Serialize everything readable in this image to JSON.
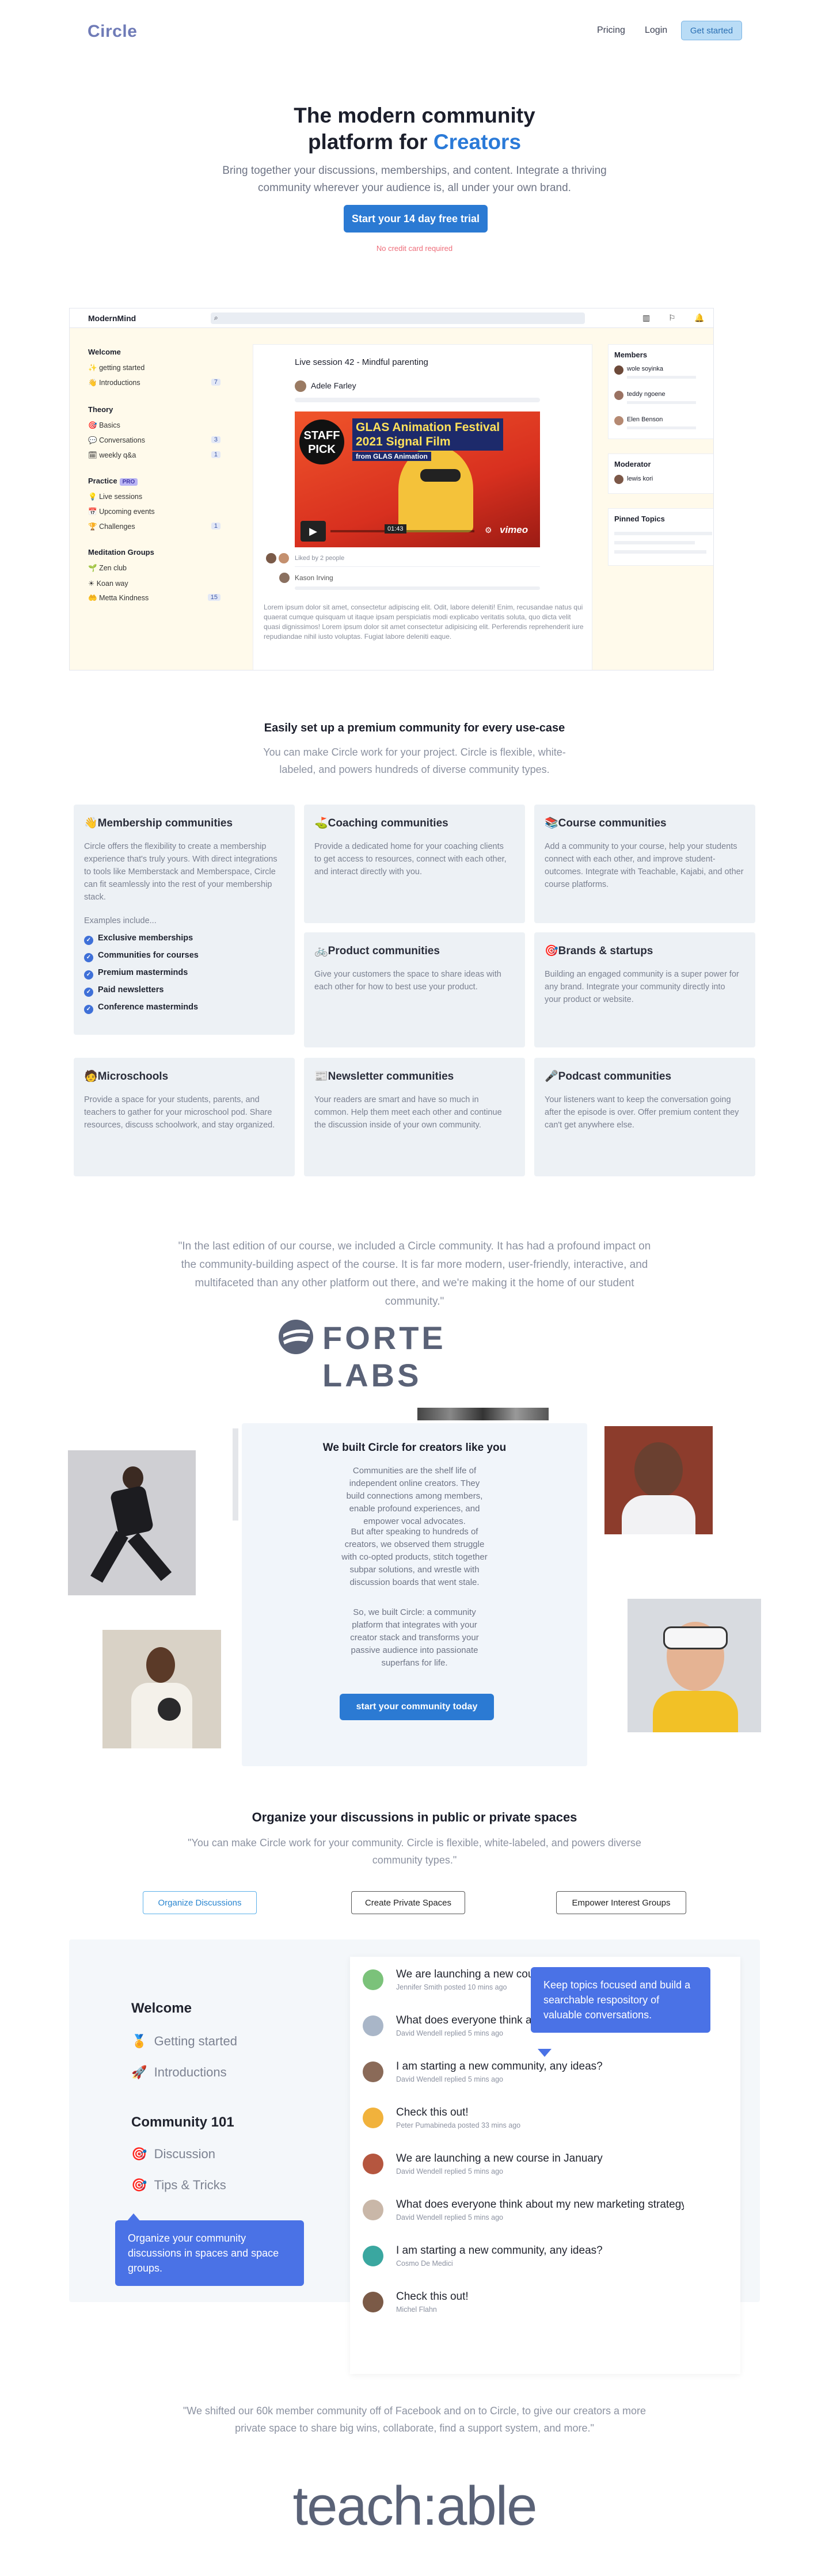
{
  "nav": {
    "logo": "Circle",
    "links": [
      "Pricing",
      "Login"
    ],
    "cta": "Get started"
  },
  "hero": {
    "title_line1": "The modern community",
    "title_line2_prefix": "platform for ",
    "title_line2_accent": "Creators",
    "subtitle": "Bring together your discussions, memberships, and content. Integrate a thriving community wherever your audience is, all under your own brand.",
    "cta": "Start your 14 day free trial",
    "note": "No credit card required"
  },
  "app": {
    "brand": "ModernMind",
    "sections": [
      {
        "title": "Welcome",
        "items": [
          {
            "label": "getting started",
            "icon": "✨",
            "count": ""
          },
          {
            "label": "Introductions",
            "icon": "👋",
            "count": "7"
          }
        ]
      },
      {
        "title": "Theory",
        "items": [
          {
            "label": "Basics",
            "icon": "🎯",
            "count": ""
          },
          {
            "label": "Conversations",
            "icon": "💬",
            "count": "3"
          },
          {
            "label": "weekly q&a",
            "icon": "🗓",
            "count": "1"
          }
        ]
      },
      {
        "title": "Practice",
        "pro": "PRO",
        "items": [
          {
            "label": "Live sessions",
            "icon": "💡",
            "count": ""
          },
          {
            "label": "Upcoming events",
            "icon": "📅",
            "count": ""
          },
          {
            "label": "Challenges",
            "icon": "🏆",
            "count": "1"
          }
        ]
      },
      {
        "title": "Meditation Groups",
        "items": [
          {
            "label": "Zen club",
            "icon": "🌱",
            "count": ""
          },
          {
            "label": "Koan way",
            "icon": "☀",
            "count": ""
          },
          {
            "label": "Metta Kindness",
            "icon": "🤲",
            "count": "15"
          }
        ]
      }
    ],
    "post_title": "Live session 42 - Mindful parenting",
    "author": "Adele Farley",
    "video": {
      "badge_line1": "STAFF",
      "badge_line2": "PICK",
      "title_line1": "GLAS Animation Festival",
      "title_line2": "2021 Signal Film",
      "from": "from GLAS Animation",
      "time": "01:43",
      "brand": "vimeo"
    },
    "liked": "Liked by 2 people",
    "commenter": "Kason Irving",
    "lorem": "Lorem ipsum dolor sit amet, consectetur adipiscing elit. Odit, labore deleniti! Enim, recusandae natus qui quaerat cumque quisquam ut itaque ipsam perspiciatis modi explicabo veritatis soluta, quo dicta velit quasi dignissimos! Lorem ipsum dolor sit amet consectetur adipisicing elit. Perferendis reprehenderit iure repudiandae nihil iusto voluptas. Fugiat labore deleniti eaque.",
    "members_title": "Members",
    "members": [
      "wole soyinka",
      "teddy ngoene",
      "Elen Benson"
    ],
    "moderator_title": "Moderator",
    "moderator": "lewis kori",
    "pinned_title": "Pinned Topics"
  },
  "usecases": {
    "title": "Easily set up a premium community for every use-case",
    "subtitle": "You can make Circle work for your project. Circle is flexible, white-labeled, and powers hundreds of diverse community types.",
    "cards": [
      {
        "title": "Membership communities",
        "icon": "👋",
        "text": "Circle offers the flexibility to create a membership experience that's truly yours. With direct integrations to tools like Memberstack and Memberspace, Circle can fit seamlessly into the rest of your membership stack.",
        "examples_label": "Examples include...",
        "examples": [
          "Exclusive memberships",
          "Communities for courses",
          "Premium masterminds",
          "Paid newsletters",
          "Conference masterminds"
        ]
      },
      {
        "title": "Coaching communities",
        "icon": "⛳",
        "text": "Provide a dedicated home for your coaching clients to get access to resources, connect with each other, and interact directly with you."
      },
      {
        "title": "Course communities",
        "icon": "📚",
        "text": "Add a community to your course, help your students connect with each other, and improve student-outcomes. Integrate with Teachable, Kajabi, and other course platforms."
      },
      {
        "title": "Product communities",
        "icon": "🚲",
        "text": "Give your customers the space to share ideas with each other for how to best use your product."
      },
      {
        "title": "Brands & startups",
        "icon": "🎯",
        "text": "Building an engaged community is a super power for any brand. Integrate your community directly into your product or website."
      },
      {
        "title": "Microschools",
        "icon": "🧑",
        "text": "Provide a space for your students, parents, and teachers to gather for your microschool pod. Share resources, discuss schoolwork, and stay organized."
      },
      {
        "title": "Newsletter communities",
        "icon": "📰",
        "text": "Your readers are smart and have so much in common. Help them meet each other and continue the discussion inside of your own community."
      },
      {
        "title": "Podcast communities",
        "icon": "🎤",
        "text": "Your listeners want to keep the conversation going after the episode is over. Offer premium content they can't get anywhere else."
      }
    ]
  },
  "quote1": {
    "text": "\"In the last edition of our course, we included a Circle community. It has had a profound impact on the community-building aspect of the course. It is far more modern, user-friendly, interactive, and multifaceted than any other platform out there, and we're making it the home of our student community.\"",
    "logo": "FORTE LABS"
  },
  "creators": {
    "title": "We built Circle for creators like you",
    "p1": "Communities are the shelf life of independent online creators. They build connections among members, enable profound experiences, and empower vocal advocates.",
    "p2": "But after speaking to hundreds of creators, we observed them struggle with co-opted products, stitch together subpar solutions, and wrestle with discussion boards that went stale.",
    "p3": "So, we built Circle: a community platform that integrates with your creator stack and transforms your passive audience into passionate superfans for life.",
    "cta": "start your community today"
  },
  "organize": {
    "title": "Organize your discussions in public or private spaces",
    "subtitle": "\"You can make Circle work for your community. Circle is flexible, white-labeled, and powers diverse community types.\"",
    "tabs": [
      "Organize Discussions",
      "Create Private Spaces",
      "Empower Interest Groups"
    ],
    "welcome": "Welcome",
    "welcome_items": [
      {
        "icon": "🏅",
        "label": "Getting started"
      },
      {
        "icon": "🚀",
        "label": "Introductions"
      }
    ],
    "community": "Community 101",
    "community_items": [
      {
        "icon": "🎯",
        "label": "Discussion"
      },
      {
        "icon": "🎯",
        "label": "Tips & Tricks"
      }
    ],
    "tip_left": "Organize your community discussions in spaces and space groups.",
    "tip_right": "Keep topics focused and build a searchable respository of valuable conversations.",
    "threads": [
      {
        "title": "We are launching a new course in January",
        "meta": "Jennifer Smith posted 10 mins ago",
        "color": "#7bc27a"
      },
      {
        "title": "What does everyone think about my new marketing strategy?",
        "meta": "David Wendell replied 5 mins ago",
        "color": "#a9b6c8"
      },
      {
        "title": "I am starting a new community, any ideas?",
        "meta": "David Wendell replied 5 mins ago",
        "color": "#8a6a58"
      },
      {
        "title": "Check this out!",
        "meta": "Peter Pumabineda posted 33 mins ago",
        "color": "#f1b23c"
      },
      {
        "title": "We are launching a new course in January",
        "meta": "David Wendell replied 5 mins ago",
        "color": "#b5563f"
      },
      {
        "title": "What does everyone think about my new marketing strategy?",
        "meta": "David Wendell replied 5 mins ago",
        "color": "#c9b7a8"
      },
      {
        "title": "I am starting a new community, any ideas?",
        "meta": "Cosmo De Medici",
        "color": "#3aa7a0"
      },
      {
        "title": "Check this out!",
        "meta": "Michel Flahn",
        "color": "#7b5a47"
      }
    ]
  },
  "quote2": {
    "text": "\"We shifted our 60k member community off of Facebook and on to Circle, to give our creators a more private space to share big wins, collaborate, find a support system, and more.\"",
    "logo": "teach:able"
  }
}
